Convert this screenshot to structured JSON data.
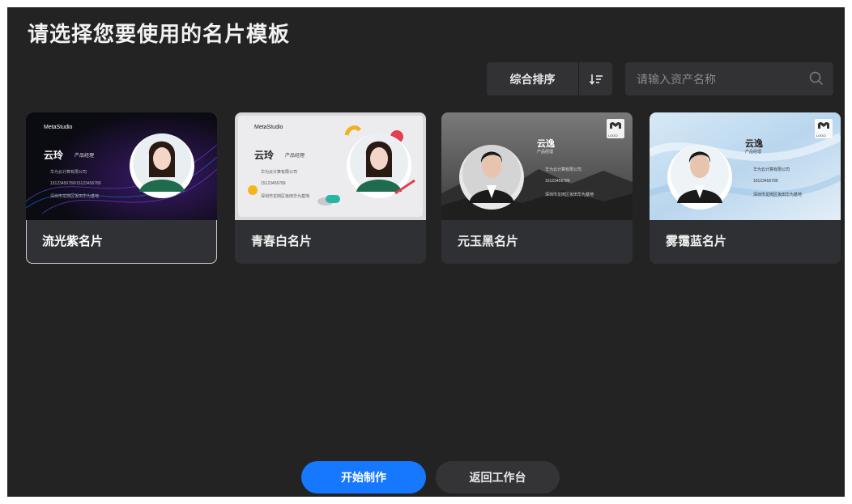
{
  "header": {
    "title": "请选择您要使用的名片模板"
  },
  "toolbar": {
    "sort_label": "综合排序",
    "sort_icon": "sort-descending-icon",
    "search_placeholder": "请输入资产名称",
    "search_icon": "search-icon"
  },
  "templates": [
    {
      "name": "流光紫名片",
      "selected": true,
      "preview": {
        "brand": "MetaStudio",
        "person": "云玲",
        "role": "产品经理",
        "lines": [
          "华为云计算有限公司",
          "15123456789/15123456789",
          "深圳市龙岗区坂田华为基地"
        ]
      }
    },
    {
      "name": "青春白名片",
      "selected": false,
      "preview": {
        "brand": "MetaStudio",
        "person": "云玲",
        "role": "产品经理",
        "lines": [
          "华为云计算有限公司",
          "15123456789",
          "深圳市龙岗区坂田华为基地"
        ]
      }
    },
    {
      "name": "元玉黑名片",
      "selected": false,
      "preview": {
        "logo": "LOGO",
        "person": "云逸",
        "role": "产品经理",
        "lines": [
          "华为云计算有限公司",
          "15123456789",
          "深圳市龙岗区坂田华为基地"
        ]
      }
    },
    {
      "name": "雾霭蓝名片",
      "selected": false,
      "preview": {
        "logo": "LOGO",
        "person": "云逸",
        "role": "产品经理",
        "lines": [
          "华为云计算有限公司",
          "15123456789",
          "深圳市龙岗区坂田华为基地"
        ]
      }
    }
  ],
  "actions": {
    "start_label": "开始制作",
    "back_label": "返回工作台"
  },
  "colors": {
    "background": "#232324",
    "card": "#2f3033",
    "accent": "#1677ff",
    "selected_border": "#cfcfd2"
  }
}
